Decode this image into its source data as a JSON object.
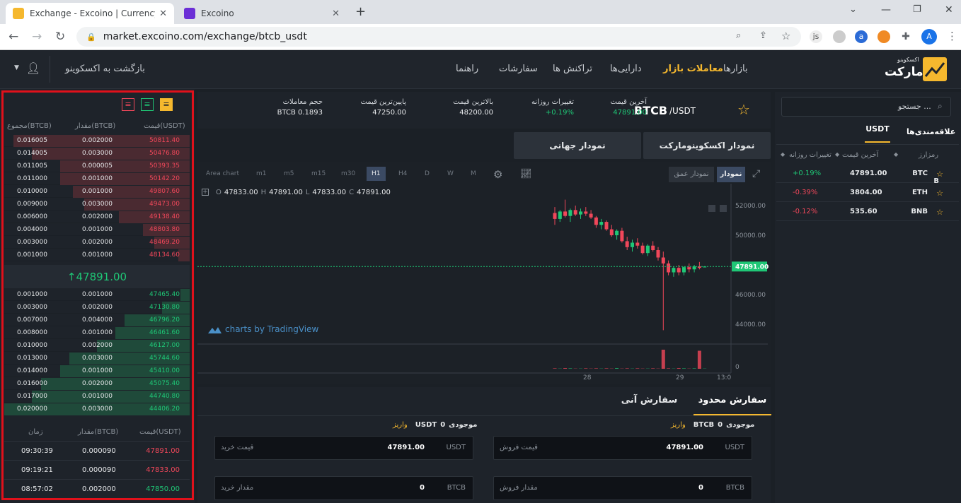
{
  "browser": {
    "tabs": [
      {
        "title": "Exchange - Excoino | Currency st",
        "active": true
      },
      {
        "title": "Excoino",
        "active": false
      }
    ],
    "url": "market.excoino.com/exchange/btcb_usdt"
  },
  "site": {
    "logo_small": "اکسکوینو",
    "logo_big": "مارکت",
    "menu": [
      "بازارها",
      "معاملات بازار",
      "دارایی‌ها",
      "تراکنش ها",
      "سفارشات",
      "راهنما"
    ],
    "back_link": "بازگشت به اکسکوینو"
  },
  "markets": {
    "search_placeholder": "جستجو ...",
    "tabs": [
      "USDT",
      "علاقه‌مندی‌ها"
    ],
    "headers": [
      "رمزارز",
      "آخرین قیمت",
      "تغییرات روزانه"
    ],
    "rows": [
      {
        "symbol": "BTC",
        "symbol2": "B",
        "price": "47891.00",
        "change": "+0.19%",
        "dir": "up"
      },
      {
        "symbol": "ETH",
        "symbol2": "",
        "price": "3804.00",
        "change": "-0.39%",
        "dir": "down"
      },
      {
        "symbol": "BNB",
        "symbol2": "",
        "price": "535.60",
        "change": "-0.12%",
        "dir": "down"
      }
    ]
  },
  "ticker": {
    "pair_base": "BTCB",
    "pair_quote": "/USDT",
    "stats": [
      {
        "label": "آخرین قیمت",
        "value": "47891.00",
        "color": "green"
      },
      {
        "label": "تغییرات روزانه",
        "value": "+0.19%",
        "color": "green"
      },
      {
        "label": "بالاترین قیمت",
        "value": "48200.00",
        "color": "white"
      },
      {
        "label": "پایین‌ترین قیمت",
        "value": "47250.00",
        "color": "white"
      },
      {
        "label": "حجم معاملات",
        "value": "BTCB 0.1893",
        "color": "white"
      }
    ]
  },
  "chart_tabs": [
    "نمودار اکسکوینومارکت",
    "نمودار جهانی"
  ],
  "chart_toolbar": {
    "timeframes": [
      "Area chart",
      "m1",
      "m5",
      "m15",
      "m30",
      "H1",
      "H4",
      "D",
      "W",
      "M"
    ],
    "active_tf": "H1",
    "view_buttons": [
      "نمودار عمق",
      "نمودار"
    ]
  },
  "chart_data": {
    "type": "candlestick",
    "ohlc_legend": {
      "O": "47833.00",
      "H": "47891.00",
      "L": "47833.00",
      "C": "47891.00"
    },
    "y_ticks": [
      "52000.00",
      "50000.00",
      "48000.00",
      "46000.00",
      "44000.00"
    ],
    "volume_tick": "0",
    "x_ticks": [
      "28",
      "29",
      "13:0"
    ],
    "last_price": "47891.00",
    "watermark": "charts by TradingView",
    "ylim": [
      43000,
      53000
    ],
    "candles": [
      [
        51500,
        51900,
        50700,
        51100
      ],
      [
        51100,
        51700,
        50900,
        51600
      ],
      [
        51600,
        52400,
        51200,
        51300
      ],
      [
        51300,
        51800,
        50900,
        51700
      ],
      [
        51700,
        52000,
        51300,
        51400
      ],
      [
        51400,
        51800,
        51100,
        51600
      ],
      [
        51600,
        51900,
        51300,
        51450
      ],
      [
        51450,
        51700,
        51100,
        51200
      ],
      [
        51200,
        51300,
        50500,
        50700
      ],
      [
        50700,
        51100,
        50400,
        50900
      ],
      [
        50900,
        51000,
        50300,
        50400
      ],
      [
        50400,
        50700,
        49900,
        50000
      ],
      [
        50000,
        50400,
        49700,
        50300
      ],
      [
        50300,
        50500,
        49500,
        49600
      ],
      [
        49600,
        49900,
        49000,
        49200
      ],
      [
        49200,
        49700,
        48900,
        49500
      ],
      [
        49500,
        49800,
        49100,
        49300
      ],
      [
        49300,
        49500,
        48700,
        48800
      ],
      [
        48800,
        49400,
        48600,
        49300
      ],
      [
        49300,
        49600,
        48900,
        49000
      ],
      [
        49000,
        49200,
        48300,
        48500
      ],
      [
        48500,
        48900,
        43600,
        48100
      ],
      [
        48100,
        48300,
        47300,
        47500
      ],
      [
        47500,
        47900,
        47200,
        47800
      ],
      [
        47800,
        48000,
        47300,
        47500
      ],
      [
        47500,
        47900,
        47300,
        47850
      ],
      [
        47850,
        48100,
        47500,
        47700
      ],
      [
        47700,
        48000,
        47500,
        47900
      ],
      [
        47900,
        48200,
        47700,
        47800
      ],
      [
        47833,
        47891,
        47833,
        47891
      ]
    ],
    "volumes": [
      0.02,
      0.01,
      0.03,
      0.02,
      0.01,
      0.01,
      0.02,
      0.01,
      0.02,
      0.01,
      0.02,
      0.01,
      0.03,
      0.01,
      0.02,
      0.01,
      0.02,
      0.01,
      0.01,
      0.02,
      0.01,
      0.9,
      0.02,
      0.01,
      0.03,
      0.02,
      0.01,
      0.02,
      0.85,
      0.01
    ]
  },
  "orderbook": {
    "headers": [
      "قیمت(USDT)",
      "مقدار(BTCB)",
      "مجموع(BTCB)"
    ],
    "asks": [
      {
        "price": "50811.40",
        "amount": "0.002000",
        "total": "0.016005",
        "depth": 0.95
      },
      {
        "price": "50476.80",
        "amount": "0.003000",
        "total": "0.014005",
        "depth": 0.85
      },
      {
        "price": "50393.35",
        "amount": "0.000005",
        "total": "0.011005",
        "depth": 0.7
      },
      {
        "price": "50142.20",
        "amount": "0.001000",
        "total": "0.011000",
        "depth": 0.7
      },
      {
        "price": "49807.60",
        "amount": "0.001000",
        "total": "0.010000",
        "depth": 0.63
      },
      {
        "price": "49473.00",
        "amount": "0.003000",
        "total": "0.009000",
        "depth": 0.57
      },
      {
        "price": "49138.40",
        "amount": "0.002000",
        "total": "0.006000",
        "depth": 0.38
      },
      {
        "price": "48803.80",
        "amount": "0.001000",
        "total": "0.004000",
        "depth": 0.25
      },
      {
        "price": "48469.20",
        "amount": "0.002000",
        "total": "0.003000",
        "depth": 0.19
      },
      {
        "price": "48134.60",
        "amount": "0.001000",
        "total": "0.001000",
        "depth": 0.06
      }
    ],
    "last_price": "↑47891.00",
    "bids": [
      {
        "price": "47465.40",
        "amount": "0.001000",
        "total": "0.001000",
        "depth": 0.05
      },
      {
        "price": "47130.80",
        "amount": "0.002000",
        "total": "0.003000",
        "depth": 0.15
      },
      {
        "price": "46796.20",
        "amount": "0.004000",
        "total": "0.007000",
        "depth": 0.35
      },
      {
        "price": "46461.60",
        "amount": "0.001000",
        "total": "0.008000",
        "depth": 0.4
      },
      {
        "price": "46127.00",
        "amount": "0.002000",
        "total": "0.010000",
        "depth": 0.5
      },
      {
        "price": "45744.60",
        "amount": "0.003000",
        "total": "0.013000",
        "depth": 0.65
      },
      {
        "price": "45410.00",
        "amount": "0.001000",
        "total": "0.014000",
        "depth": 0.7
      },
      {
        "price": "45075.40",
        "amount": "0.002000",
        "total": "0.016000",
        "depth": 0.8
      },
      {
        "price": "44740.80",
        "amount": "0.001000",
        "total": "0.017000",
        "depth": 0.85
      },
      {
        "price": "44406.20",
        "amount": "0.003000",
        "total": "0.020000",
        "depth": 1.0
      }
    ]
  },
  "trades": {
    "headers": [
      "قیمت(USDT)",
      "مقدار(BTCB)",
      "زمان"
    ],
    "rows": [
      {
        "price": "47891.00",
        "amount": "0.000090",
        "time": "09:30:39",
        "dir": "down"
      },
      {
        "price": "47833.00",
        "amount": "0.000090",
        "time": "09:19:21",
        "dir": "down"
      },
      {
        "price": "47850.00",
        "amount": "0.002000",
        "time": "08:57:02",
        "dir": "up"
      }
    ]
  },
  "order_form": {
    "tabs": [
      "سفارش محدود",
      "سفارش آنی"
    ],
    "sell": {
      "balance_label": "موجودی",
      "balance_value": "0",
      "balance_unit": "BTCB",
      "deposit": "واریز",
      "price_label": "قیمت فروش",
      "price_value": "47891.00",
      "price_unit": "USDT",
      "amount_label": "مقدار فروش",
      "amount_value": "0",
      "amount_unit": "BTCB"
    },
    "buy": {
      "balance_label": "موجودی",
      "balance_value": "0",
      "balance_unit": "USDT",
      "deposit": "واریز",
      "price_label": "قیمت خرید",
      "price_value": "47891.00",
      "price_unit": "USDT",
      "amount_label": "مقدار خرید",
      "amount_value": "0",
      "amount_unit": "BTCB"
    }
  },
  "colors": {
    "accent": "#f5b82e",
    "up": "#1fc776",
    "down": "#f0475a",
    "highlight_border": "#e0111b"
  }
}
